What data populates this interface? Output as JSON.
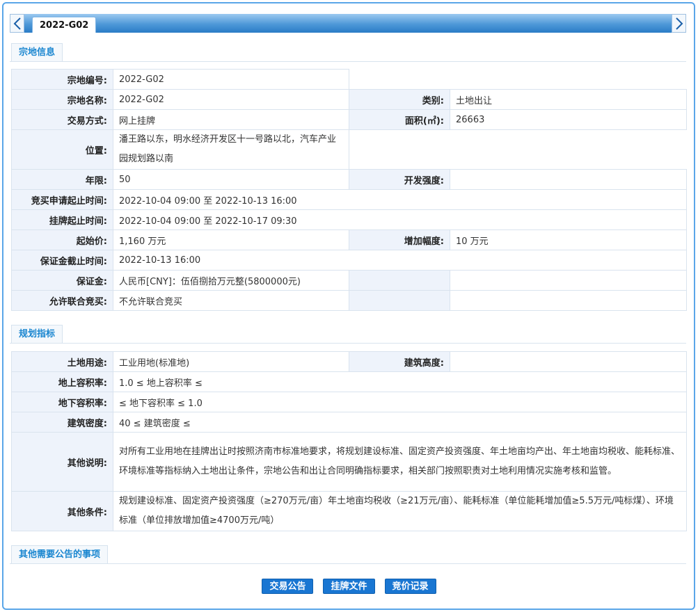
{
  "tab": {
    "label": "2022-G02"
  },
  "sections": {
    "parcel_info": "宗地信息",
    "planning": "规划指标",
    "other_notice": "其他需要公告的事项"
  },
  "parcel": {
    "id_label": "宗地编号:",
    "id_value": "2022-G02",
    "name_label": "宗地名称:",
    "name_value": "2022-G02",
    "type_label": "类别:",
    "type_value": "土地出让",
    "trade_label": "交易方式:",
    "trade_value": "网上挂牌",
    "area_label": "面积(㎡):",
    "area_value": "26663",
    "location_label": "位置:",
    "location_value": "潘王路以东，明水经济开发区十一号路以北，汽车产业园规划路以南",
    "years_label": "年限:",
    "years_value": "50",
    "intensity_label": "开发强度:",
    "intensity_value": "",
    "apply_label": "竞买申请起止时间:",
    "apply_value": "2022-10-04 09:00 至 2022-10-13 16:00",
    "listing_label": "挂牌起止时间:",
    "listing_value": "2022-10-04 09:00 至 2022-10-17 09:30",
    "start_price_label": "起始价:",
    "start_price_value": "1,160 万元",
    "increment_label": "增加幅度:",
    "increment_value": "10 万元",
    "deposit_deadline_label": "保证金截止时间:",
    "deposit_deadline_value": "2022-10-13 16:00",
    "deposit_label": "保证金:",
    "deposit_value": "人民币[CNY]：伍佰捌拾万元整(5800000元)",
    "joint_label": "允许联合竞买:",
    "joint_value": "不允许联合竞买"
  },
  "planning": {
    "use_label": "土地用途:",
    "use_value": "工业用地(标准地)",
    "height_label": "建筑高度:",
    "height_value": "",
    "far_above_label": "地上容积率:",
    "far_above_value": "1.0 ≤ 地上容积率 ≤",
    "far_below_label": "地下容积率:",
    "far_below_value": "≤ 地下容积率 ≤ 1.0",
    "density_label": "建筑密度:",
    "density_value": "40 ≤ 建筑密度 ≤",
    "notes_label": "其他说明:",
    "notes_value": "对所有工业用地在挂牌出让时按照济南市标准地要求，将规划建设标准、固定资产投资强度、年土地亩均产出、年土地亩均税收、能耗标准、环境标准等指标纳入土地出让条件，宗地公告和出让合同明确指标要求，相关部门按照职责对土地利用情况实施考核和监管。",
    "conditions_label": "其他条件:",
    "conditions_value": "规划建设标准、固定资产投资强度（≥270万元/亩）年土地亩均税收（≥21万元/亩）、能耗标准（单位能耗增加值≥5.5万元/吨标煤）、环境标准（单位排放增加值≥4700万元/吨）"
  },
  "buttons": {
    "announcement": "交易公告",
    "documents": "挂牌文件",
    "records": "竞价记录"
  },
  "colors": {
    "accent": "#1976d2",
    "tabbar": "#4e98d8",
    "label_bg": "#eef3fb"
  }
}
